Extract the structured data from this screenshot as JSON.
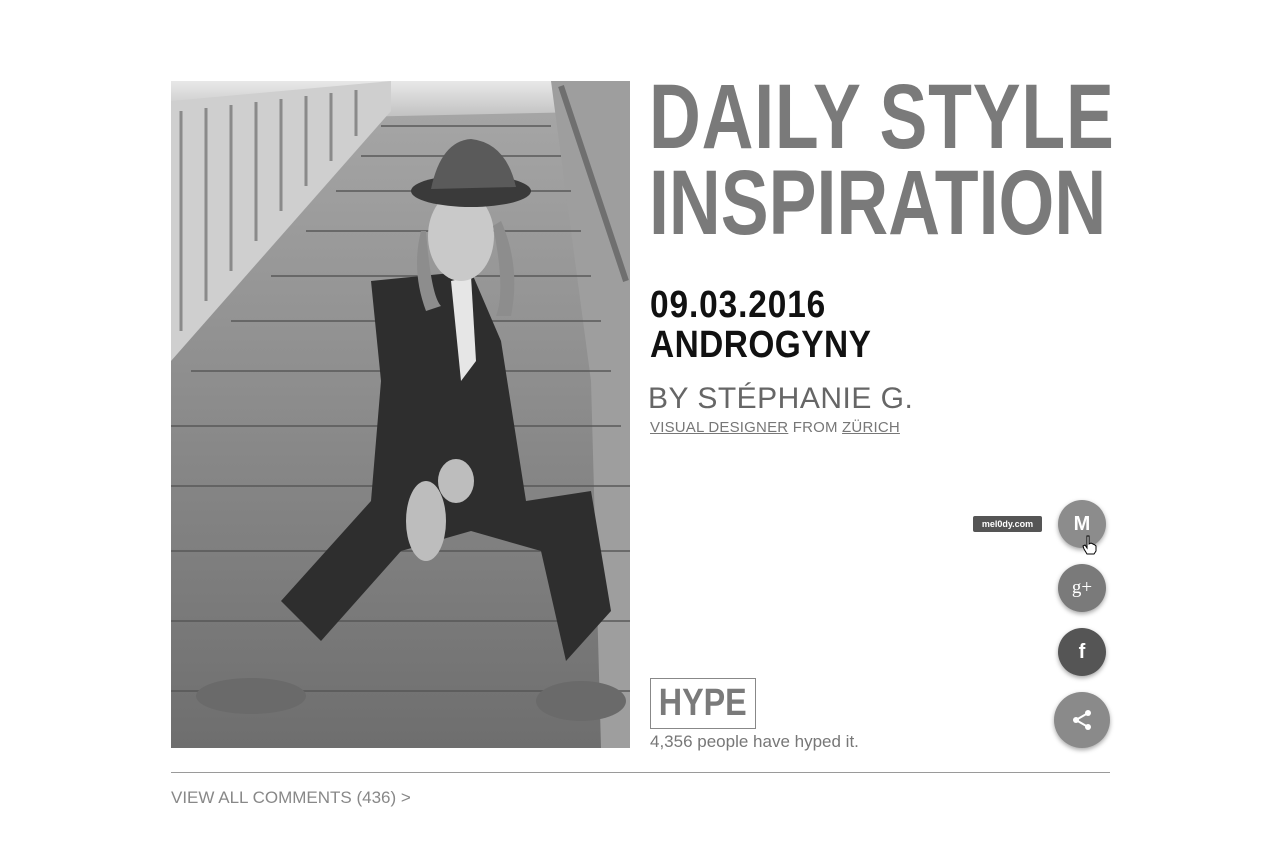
{
  "header": {
    "title_word1": "DAILY",
    "title_word2": "STYLE",
    "title_line2": "INSPIRATION"
  },
  "post": {
    "date": "09.03.2016",
    "topic": "ANDROGYNY",
    "author": "BY STÉPHANIE G.",
    "author_role": "VISUAL DESIGNER",
    "author_from": "FROM",
    "author_city": "ZÜRICH"
  },
  "hype": {
    "button_label": "HYPE",
    "count_text": "4,356 people have hyped it."
  },
  "comments": {
    "link_label": "VIEW ALL COMMENTS (436) >"
  },
  "share_menu": {
    "tooltip": "mel0dy.com",
    "m_label": "M",
    "gplus_label": "g+",
    "facebook_label": "f",
    "items": [
      {
        "icon": "mel0dy-icon"
      },
      {
        "icon": "google-plus-icon"
      },
      {
        "icon": "facebook-icon"
      },
      {
        "icon": "share-icon"
      }
    ]
  },
  "colors": {
    "title_gray": "#7a7a7a",
    "text_black": "#111111",
    "muted": "#777777",
    "fab_dark": "#555555",
    "fab_light": "#8c8c8c"
  }
}
